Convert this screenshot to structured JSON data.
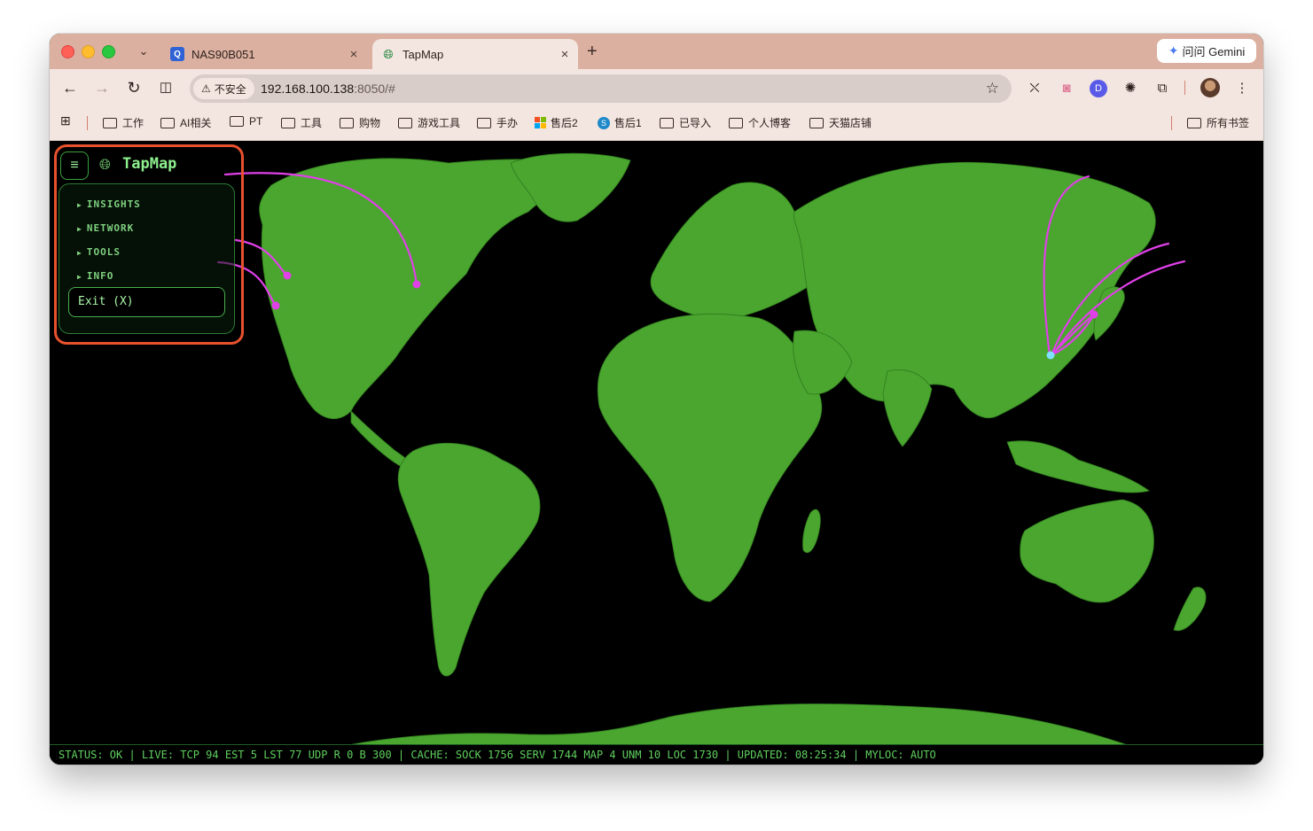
{
  "browser": {
    "tabs": [
      {
        "title": "NAS90B051",
        "favicon": "nas-icon"
      },
      {
        "title": "TapMap",
        "favicon": "globe-icon"
      }
    ],
    "gemini_label": "问问 Gemini",
    "insecure_label": "不安全",
    "url_host": "192.168.100.138",
    "url_path": ":8050/#",
    "bookmarks": [
      {
        "label": "工作",
        "icon": "folder-icon"
      },
      {
        "label": "AI相关",
        "icon": "folder-icon"
      },
      {
        "label": "PT",
        "icon": "folder-icon"
      },
      {
        "label": "工具",
        "icon": "folder-icon"
      },
      {
        "label": "购物",
        "icon": "folder-icon"
      },
      {
        "label": "游戏工具",
        "icon": "folder-icon"
      },
      {
        "label": "手办",
        "icon": "folder-icon"
      },
      {
        "label": "售后2",
        "icon": "microsoft-icon"
      },
      {
        "label": "售后1",
        "icon": "sharepoint-icon"
      },
      {
        "label": "已导入",
        "icon": "folder-icon"
      },
      {
        "label": "个人博客",
        "icon": "folder-icon"
      },
      {
        "label": "天猫店铺",
        "icon": "folder-icon"
      }
    ],
    "all_bookmarks_label": "所有书签"
  },
  "app": {
    "title": "TapMap",
    "menu": {
      "items": [
        "INSIGHTS",
        "NETWORK",
        "TOOLS",
        "INFO"
      ],
      "exit_label": "Exit (X)"
    },
    "status_line": "STATUS: OK | LIVE: TCP 94 EST 5 LST 77 UDP R 0 B 300 | CACHE: SOCK 1756 SERV 1744 MAP 4 UNM 10 LOC 1730 | UPDATED: 08:25:34 | MYLOC: AUTO"
  },
  "colors": {
    "land": "#4aa62e",
    "ocean": "#000000",
    "connection": "#e040e8",
    "home_node": "#7fe0ff",
    "highlight_outline": "#e8512e"
  }
}
